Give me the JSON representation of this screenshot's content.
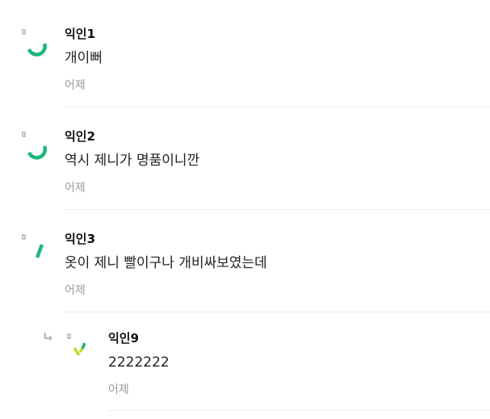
{
  "comments": [
    {
      "author": "익인1",
      "text": "개이뻐",
      "time": "어제",
      "avatar_color": "#1db77a"
    },
    {
      "author": "익인2",
      "text": "역시 제니가 명품이니깐",
      "time": "어제",
      "avatar_color": "#1db77a"
    },
    {
      "author": "익인3",
      "text": "옷이 제니 빨이구나 개비싸보였는데",
      "time": "어제",
      "avatar_color": "#1db77a"
    }
  ],
  "replies": [
    {
      "author": "익인9",
      "text": "2222222",
      "time": "어제",
      "avatar_color": "#c6d92a"
    }
  ],
  "icons": {
    "reply_arrow": "reply-arrow-icon"
  }
}
